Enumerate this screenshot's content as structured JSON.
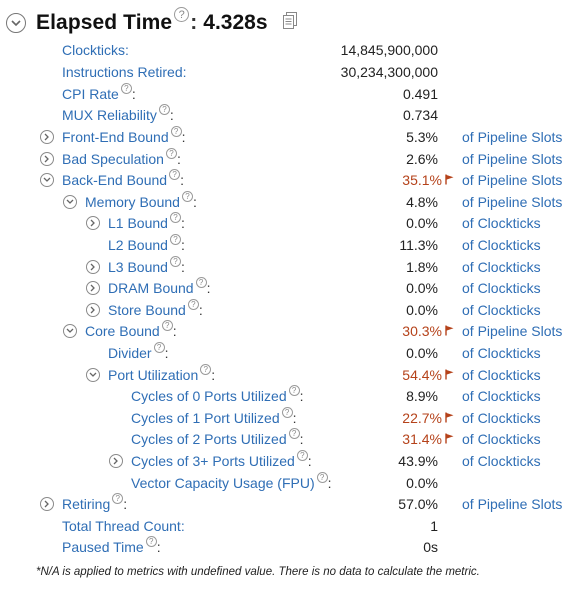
{
  "header": {
    "title": "Elapsed Time",
    "colon": ":",
    "value": "4.328s"
  },
  "rows": [
    {
      "label": "Clockticks:",
      "value": "14,845,900,000",
      "unit": ""
    },
    {
      "label": "Instructions Retired:",
      "value": "30,234,300,000",
      "unit": ""
    },
    {
      "label": "CPI Rate",
      "value": "0.491",
      "unit": ""
    },
    {
      "label": "MUX Reliability",
      "value": "0.734",
      "unit": ""
    },
    {
      "label": "Front-End Bound",
      "value": "5.3%",
      "unit": "of Pipeline Slots"
    },
    {
      "label": "Bad Speculation",
      "value": "2.6%",
      "unit": "of Pipeline Slots"
    },
    {
      "label": "Back-End Bound",
      "value": "35.1%",
      "unit": "of Pipeline Slots"
    },
    {
      "label": "Memory Bound",
      "value": "4.8%",
      "unit": "of Pipeline Slots"
    },
    {
      "label": "L1 Bound",
      "value": "0.0%",
      "unit": "of Clockticks"
    },
    {
      "label": "L2 Bound",
      "value": "11.3%",
      "unit": "of Clockticks"
    },
    {
      "label": "L3 Bound",
      "value": "1.8%",
      "unit": "of Clockticks"
    },
    {
      "label": "DRAM Bound",
      "value": "0.0%",
      "unit": "of Clockticks"
    },
    {
      "label": "Store Bound",
      "value": "0.0%",
      "unit": "of Clockticks"
    },
    {
      "label": "Core Bound",
      "value": "30.3%",
      "unit": "of Pipeline Slots"
    },
    {
      "label": "Divider",
      "value": "0.0%",
      "unit": "of Clockticks"
    },
    {
      "label": "Port Utilization",
      "value": "54.4%",
      "unit": "of Clockticks"
    },
    {
      "label": "Cycles of 0 Ports Utilized",
      "value": "8.9%",
      "unit": "of Clockticks"
    },
    {
      "label": "Cycles of 1 Port Utilized",
      "value": "22.7%",
      "unit": "of Clockticks"
    },
    {
      "label": "Cycles of 2 Ports Utilized",
      "value": "31.4%",
      "unit": "of Clockticks"
    },
    {
      "label": "Cycles of 3+ Ports Utilized",
      "value": "43.9%",
      "unit": "of Clockticks"
    },
    {
      "label": "Vector Capacity Usage (FPU)",
      "value": "0.0%",
      "unit": ""
    },
    {
      "label": "Retiring",
      "value": "57.0%",
      "unit": "of Pipeline Slots"
    },
    {
      "label": "Total Thread Count:",
      "value": "1",
      "unit": ""
    },
    {
      "label": "Paused Time",
      "value": "0s",
      "unit": ""
    }
  ],
  "footnote": "*N/A is applied to metrics with undefined value. There is no data to calculate the metric.",
  "colors": {
    "link": "#2f6eb5",
    "hot": "#b5421a",
    "text": "#222222"
  }
}
